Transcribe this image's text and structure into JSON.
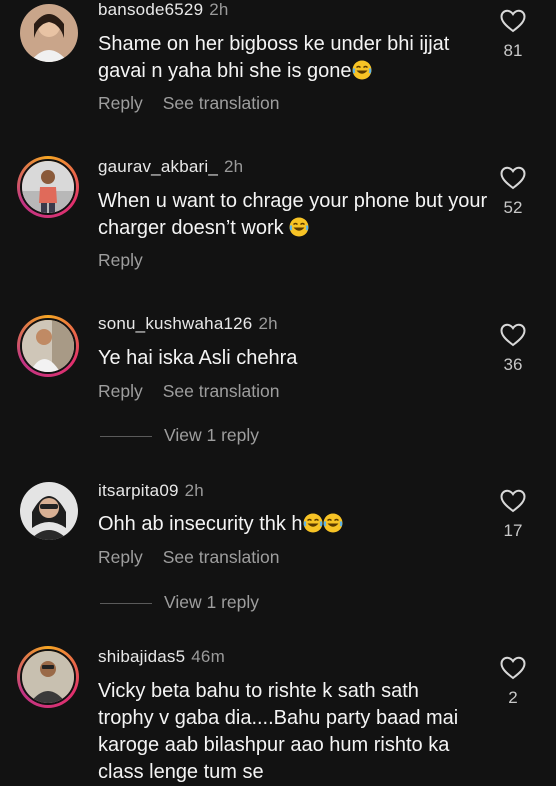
{
  "actions": {
    "reply": "Reply",
    "translate": "See translation"
  },
  "comments": [
    {
      "username": "bansode6529",
      "time": "2h",
      "text": "Shame on her bigboss ke under bhi ijjat gavai n yaha bhi she is gone",
      "likes": "81",
      "has_translation": true
    },
    {
      "username": "gaurav_akbari_",
      "time": "2h",
      "text": "When u want to chrage your phone but your charger doesn’t work",
      "likes": "52",
      "has_translation": false
    },
    {
      "username": "sonu_kushwaha126",
      "time": "2h",
      "text": "Ye hai iska Asli chehra",
      "likes": "36",
      "has_translation": true,
      "replies": "View 1 reply"
    },
    {
      "username": "itsarpita09",
      "time": "2h",
      "text": "Ohh ab insecurity thk h",
      "likes": "17",
      "has_translation": true,
      "replies": "View 1 reply"
    },
    {
      "username": "shibajidas5",
      "time": "46m",
      "text": "Vicky beta bahu to rishte k sath sath trophy v gaba dia....Bahu party baad mai karoge aab bilashpur aao hum rishto ka class lenge tum se",
      "likes": "2",
      "has_translation": false
    }
  ]
}
